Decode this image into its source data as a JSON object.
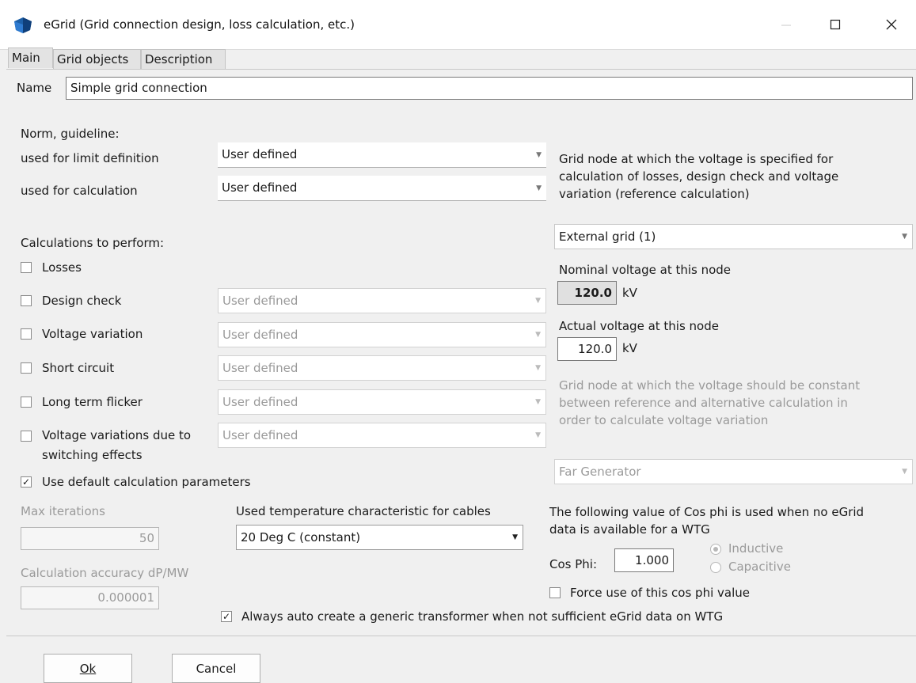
{
  "window": {
    "title": "eGrid (Grid connection design, loss calculation, etc.)",
    "app_icon": "egrid-app-icon",
    "controls": {
      "minimize": "minimize-icon",
      "maximize": "maximize-icon",
      "close": "close-icon"
    }
  },
  "tabs": [
    {
      "label": "Main",
      "active": true
    },
    {
      "label": "Grid objects",
      "active": false
    },
    {
      "label": "Description",
      "active": false
    }
  ],
  "main": {
    "name_label": "Name",
    "name_value": "Simple grid connection",
    "norm_heading": "Norm, guideline:",
    "limit_label": "used for limit definition",
    "limit_value": "User defined",
    "calc_label": "used for calculation",
    "calc_value": "User defined",
    "calculations_heading": "Calculations to perform:",
    "calculations": [
      {
        "label": "Losses",
        "checked": false
      },
      {
        "label": "Design check",
        "checked": false,
        "method": "User defined"
      },
      {
        "label": "Voltage variation",
        "checked": false,
        "method": "User defined"
      },
      {
        "label": "Short circuit",
        "checked": false,
        "method": "User defined"
      },
      {
        "label": "Long term flicker",
        "checked": false,
        "method": "User defined"
      },
      {
        "label": "Voltage variations due to",
        "label2": "switching effects",
        "checked": false,
        "method": "User defined"
      }
    ],
    "use_default_params": {
      "label": "Use default calculation parameters",
      "checked": true
    },
    "max_iterations_label": "Max iterations",
    "max_iterations_value": "50",
    "accuracy_label": "Calculation accuracy dP/MW",
    "accuracy_value": "0.000001",
    "temp_label": "Used temperature characteristic for cables",
    "temp_value": "20 Deg C (constant)",
    "auto_transformer": {
      "label": "Always auto create a generic transformer when not sufficient eGrid data on WTG",
      "checked": true
    }
  },
  "right": {
    "ref_node_text": [
      "Grid node at which the voltage is specified for",
      "calculation of losses, design check and voltage",
      "variation (reference calculation)"
    ],
    "ref_node_value": "External grid (1)",
    "nominal_label": "Nominal voltage at this node",
    "nominal_value": "120.0",
    "nominal_unit": "kV",
    "actual_label": "Actual voltage at this node",
    "actual_value": "120.0",
    "actual_unit": "kV",
    "const_node_text": [
      "Grid node at which the voltage should be constant",
      "between reference and alternative calculation in",
      "order to calculate voltage variation"
    ],
    "const_node_value": "Far Generator",
    "cosphi_text": [
      "The following value of Cos phi is used when no eGrid",
      "data is available for a WTG"
    ],
    "cosphi_label": "Cos Phi:",
    "cosphi_value": "1.000",
    "inductive_label": "Inductive",
    "capacitive_label": "Capacitive",
    "force_label": "Force use of this cos phi value",
    "force_checked": false
  },
  "footer": {
    "ok_label": "Ok",
    "cancel_label": "Cancel"
  }
}
